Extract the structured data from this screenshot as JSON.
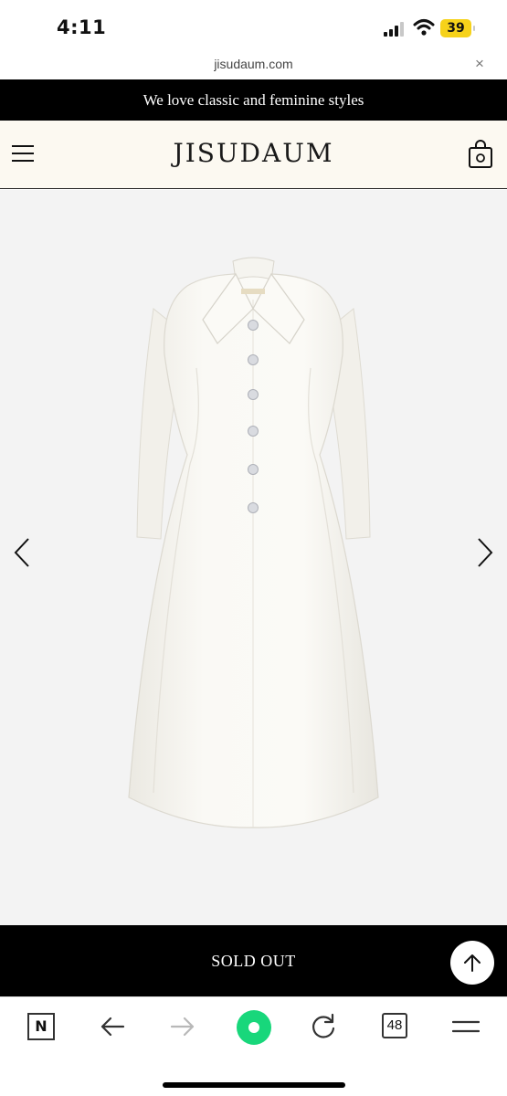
{
  "status_bar": {
    "time": "4:11",
    "battery": "39"
  },
  "browser": {
    "url": "jisudaum.com",
    "close_glyph": "×",
    "tab_count": "48",
    "n_label": "N"
  },
  "banner": {
    "text": "We love classic and feminine styles"
  },
  "header": {
    "brand": "JISUDAUM"
  },
  "product": {
    "status": "SOLD OUT"
  },
  "icons": {
    "menu": "hamburger-icon",
    "cart": "shopping-bag-icon",
    "prev": "chevron-left-icon",
    "next": "chevron-right-icon",
    "scroll_top": "arrow-up-icon"
  },
  "colors": {
    "banner_bg": "#000000",
    "header_bg": "#fcf9f1",
    "gallery_bg": "#f3f3f3",
    "home_button": "#18d77b",
    "battery": "#f6d21a"
  }
}
